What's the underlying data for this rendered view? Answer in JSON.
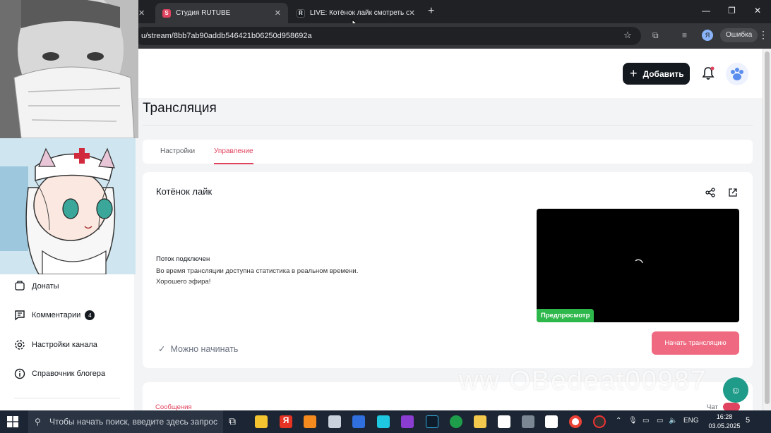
{
  "browser": {
    "tabs": [
      {
        "title": "Студия RUTUBE",
        "favicon": "S",
        "favicon_color": "#e0435f",
        "active": true
      },
      {
        "title": "LIVE: Котёнок лайк смотреть о",
        "favicon": "R",
        "favicon_color": "#14191f",
        "active": false
      }
    ],
    "address": "u/stream/8bb7ab90addb546421b06250d958692a",
    "profile_letter": "Я",
    "error_label": "Ошибка"
  },
  "header": {
    "add_label": "Добавить"
  },
  "page": {
    "title": "Трансляция",
    "tabs": [
      {
        "label": "Настройки",
        "active": false
      },
      {
        "label": "Управление",
        "active": true
      }
    ]
  },
  "stream": {
    "name": "Котёнок лайк",
    "status_title": "Поток подключен",
    "status_line1": "Во время трансляции доступна статистика в реальном времени.",
    "status_line2": "Хорошего эфира!",
    "preview_badge": "Предпросмотр",
    "ready_label": "Можно начинать",
    "start_label": "Начать трансляцию"
  },
  "bottom_card": {
    "messages_label": "Сообщения",
    "chat_label": "Чат"
  },
  "sidebar": {
    "items": [
      {
        "label": "Донаты",
        "icon": "donate-icon",
        "badge": null
      },
      {
        "label": "Комментарии",
        "icon": "comment-icon",
        "badge": "4"
      },
      {
        "label": "Настройки канала",
        "icon": "gear-icon",
        "badge": null
      },
      {
        "label": "Справочник блогера",
        "icon": "info-icon",
        "badge": null
      }
    ]
  },
  "watermark": "ww OBedeat00987",
  "taskbar": {
    "search_placeholder": "Чтобы начать поиск, введите здесь запрос",
    "language": "ENG",
    "time": "16:28",
    "date": "03.05.2025",
    "notifications": "5"
  },
  "colors": {
    "accent": "#e0435f",
    "start_button": "#ef6a80",
    "preview_badge": "#2eb84b",
    "dark_button": "#14191f"
  }
}
